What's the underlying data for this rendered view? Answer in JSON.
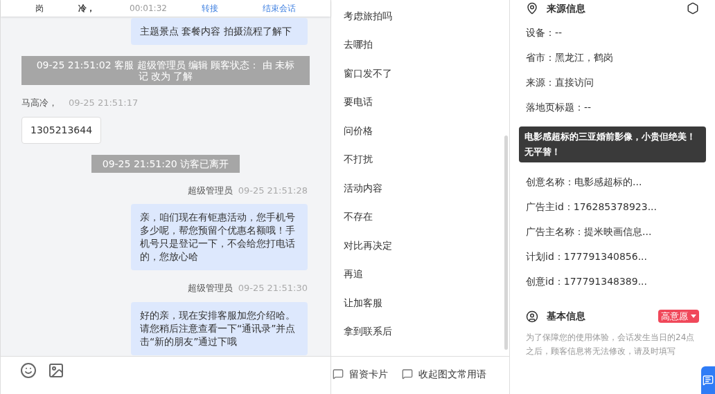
{
  "chat_header": {
    "visitor": "岗",
    "name": "冷，",
    "duration": "00:01:32",
    "actions": [
      "转接",
      "结束会话"
    ]
  },
  "messages": [
    {
      "kind": "agent",
      "text": "主题景点 套餐内容 拍摄流程了解下"
    },
    {
      "kind": "system",
      "text": "09-25 21:51:02 客服 超级管理员 编辑 顾客状态： 由 未标记 改为 了解"
    },
    {
      "kind": "visitor",
      "sender": "马高冷，",
      "time": "09-25 21:51:17",
      "text": "1305213644"
    },
    {
      "kind": "system",
      "text": "09-25 21:51:20 访客已离开"
    },
    {
      "kind": "agent",
      "sender": "超级管理员",
      "time": "09-25 21:51:28",
      "text": "亲，咱们现在有钜惠活动，您手机号多少呢，帮您预留个优惠名额哦！手机号只是登记一下，不会给您打电话的，您放心哈"
    },
    {
      "kind": "agent",
      "sender": "超级管理员",
      "time": "09-25 21:51:30",
      "text": "好的亲，现在安排客服加您介绍哈。请您稍后注意查看一下“通讯录”并点击“新的朋友”通过下哦"
    }
  ],
  "quick_replies": [
    "考虑旅拍吗",
    "去哪拍",
    "窗口发不了",
    "要电话",
    "问价格",
    "不打扰",
    "活动内容",
    "不存在",
    "对比再决定",
    "再追",
    "让加客服",
    "拿到联系后"
  ],
  "bottom_actions": [
    "留资卡片",
    "收起图文常用语"
  ],
  "source_info": {
    "title": "来源信息",
    "fields": [
      "设备：--",
      "省市：黑龙江，鹤岗",
      "来源：直接访问",
      "落地页标题：--",
      "创意名称：电影感超标的...",
      "广告主id：176285378923...",
      "广告主名称：提米映画信息...",
      "计划id：177791340856...",
      "创意id：177791348389..."
    ],
    "tooltip": "电影感超标的三亚婚前影像，小贵但绝美！无平替！"
  },
  "basic_info": {
    "title": "基本信息",
    "intent": "高意愿",
    "notice": "为了保障您的使用体验，会话发生当日的24点之后，顾客信息将无法修改，请及时填写"
  }
}
